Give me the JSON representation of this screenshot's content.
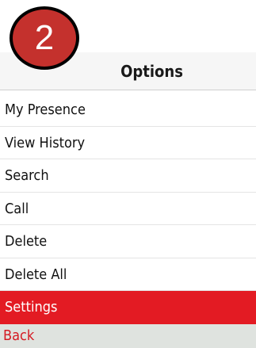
{
  "step_badge": "2",
  "header": {
    "title": "Options"
  },
  "menu": {
    "items": [
      {
        "label": "My Presence"
      },
      {
        "label": "View History"
      },
      {
        "label": "Search"
      },
      {
        "label": "Call"
      },
      {
        "label": "Delete"
      },
      {
        "label": "Delete All"
      },
      {
        "label": "Settings",
        "selected": true
      }
    ]
  },
  "softkeys": {
    "left": "Back"
  },
  "colors": {
    "selection": "#e31b23",
    "badge": "#c4312d",
    "softkey_text": "#d51a22",
    "softkey_bar": "#dfe3df"
  }
}
